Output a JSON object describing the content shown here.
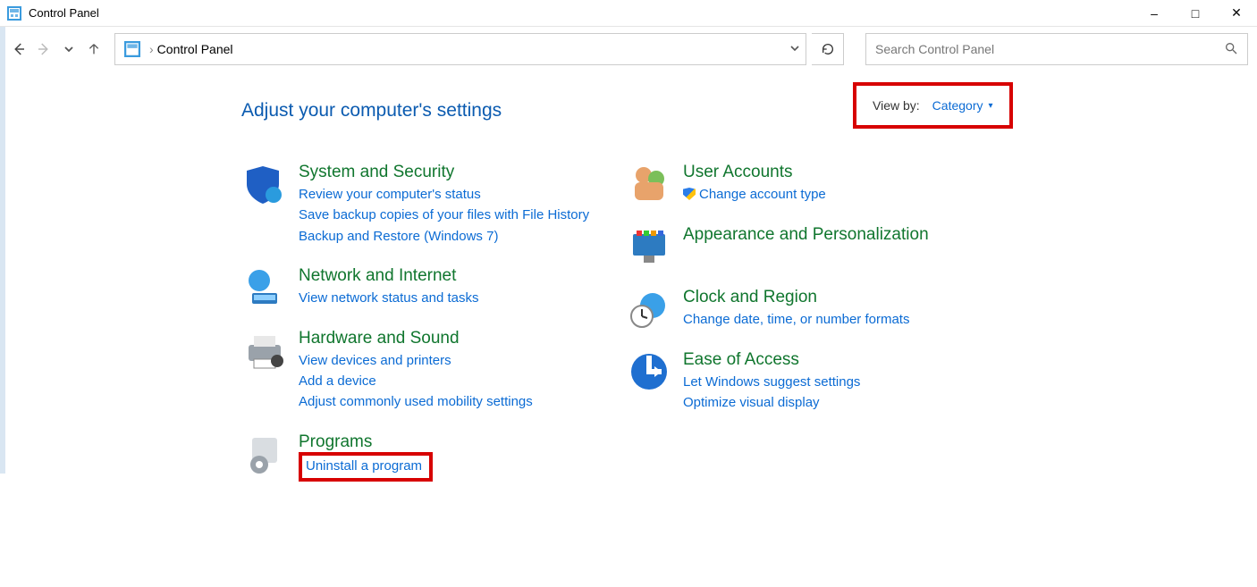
{
  "window": {
    "title": "Control Panel"
  },
  "breadcrumb": {
    "label": "Control Panel"
  },
  "search": {
    "placeholder": "Search Control Panel"
  },
  "heading": "Adjust your computer's settings",
  "viewby": {
    "label": "View by:",
    "value": "Category"
  },
  "left_column": [
    {
      "title": "System and Security",
      "links": [
        "Review your computer's status",
        "Save backup copies of your files with File History",
        "Backup and Restore (Windows 7)"
      ]
    },
    {
      "title": "Network and Internet",
      "links": [
        "View network status and tasks"
      ]
    },
    {
      "title": "Hardware and Sound",
      "links": [
        "View devices and printers",
        "Add a device",
        "Adjust commonly used mobility settings"
      ]
    },
    {
      "title": "Programs",
      "links": [
        "Uninstall a program"
      ]
    }
  ],
  "right_column": [
    {
      "title": "User Accounts",
      "links": [
        "Change account type"
      ]
    },
    {
      "title": "Appearance and Personalization",
      "links": []
    },
    {
      "title": "Clock and Region",
      "links": [
        "Change date, time, or number formats"
      ]
    },
    {
      "title": "Ease of Access",
      "links": [
        "Let Windows suggest settings",
        "Optimize visual display"
      ]
    }
  ]
}
